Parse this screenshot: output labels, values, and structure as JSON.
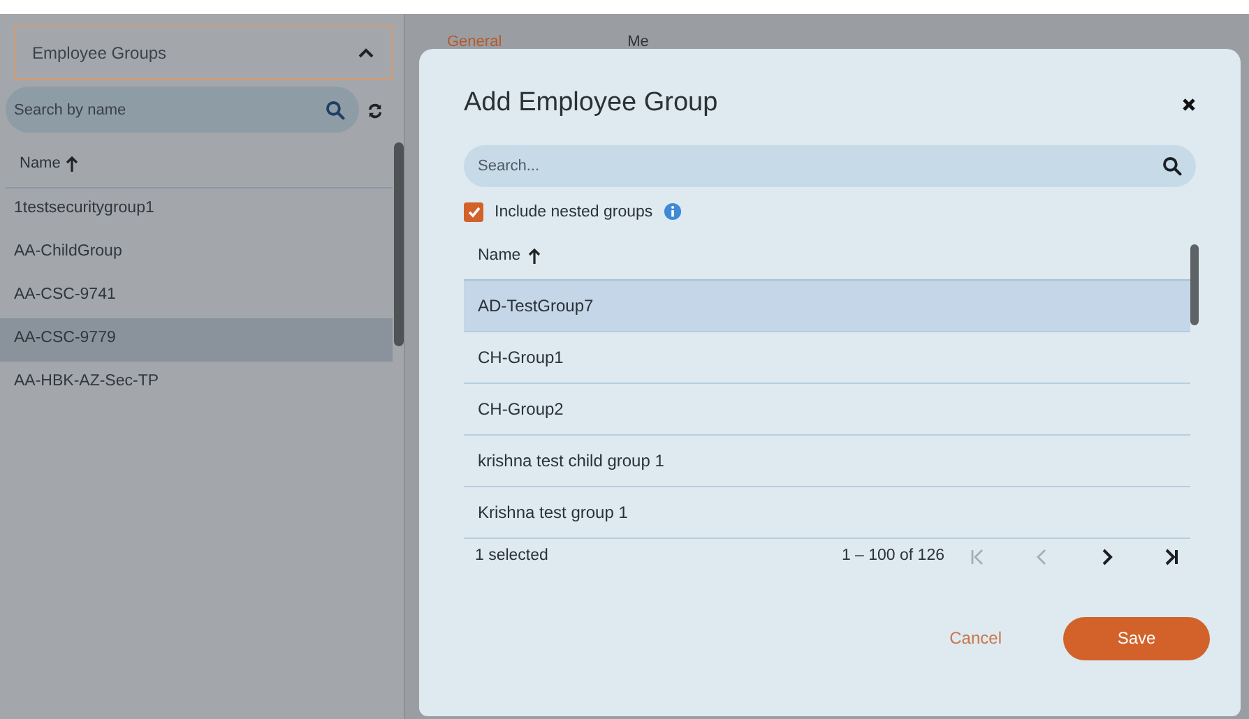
{
  "left_panel": {
    "dropdown": {
      "label": "Employee Groups",
      "expanded": true
    },
    "search": {
      "placeholder": "Search by name"
    },
    "column": "Name",
    "rows": [
      {
        "name": "1testsecuritygroup1",
        "selected": false
      },
      {
        "name": "AA-ChildGroup",
        "selected": false
      },
      {
        "name": "AA-CSC-9741",
        "selected": false
      },
      {
        "name": "AA-CSC-9779",
        "selected": true
      },
      {
        "name": "AA-HBK-AZ-Sec-TP",
        "selected": false
      }
    ]
  },
  "tabs": [
    {
      "label": "General",
      "selected": true
    },
    {
      "label": "Me",
      "selected": false
    }
  ],
  "dialog": {
    "title": "Add Employee Group",
    "search": {
      "placeholder": "Search..."
    },
    "include_nested": {
      "label": "Include nested groups",
      "checked": true
    },
    "column": "Name",
    "rows": [
      {
        "name": "AD-TestGroup7",
        "selected": true
      },
      {
        "name": "CH-Group1",
        "selected": false
      },
      {
        "name": "CH-Group2",
        "selected": false
      },
      {
        "name": "krishna test child group 1",
        "selected": false
      },
      {
        "name": "Krishna test group 1",
        "selected": false
      }
    ],
    "footer": {
      "selection": "1 selected",
      "range": "1 – 100 of 126",
      "pager": [
        {
          "kind": "first",
          "disabled": true
        },
        {
          "kind": "previous",
          "disabled": true
        },
        {
          "kind": "next",
          "disabled": false
        },
        {
          "kind": "last",
          "disabled": false
        }
      ]
    },
    "buttons": [
      {
        "kind": "secondary",
        "label": "Cancel"
      },
      {
        "kind": "primary",
        "label": "Save"
      }
    ]
  }
}
